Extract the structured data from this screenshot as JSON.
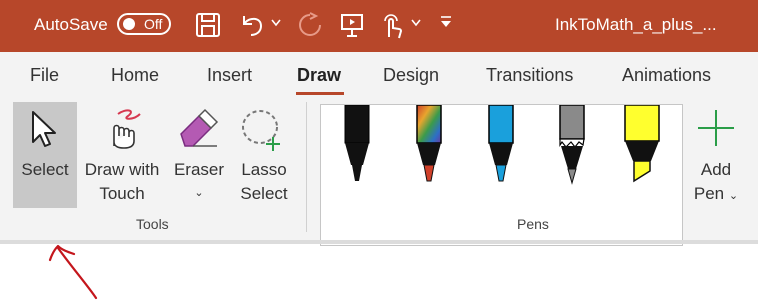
{
  "titlebar": {
    "autosave_label": "AutoSave",
    "autosave_state": "Off",
    "document_title": "InkToMath_a_plus_..."
  },
  "tabs": [
    {
      "label": "File"
    },
    {
      "label": "Home"
    },
    {
      "label": "Insert"
    },
    {
      "label": "Draw",
      "active": true
    },
    {
      "label": "Design"
    },
    {
      "label": "Transitions"
    },
    {
      "label": "Animations"
    }
  ],
  "tools_group": {
    "label": "Tools",
    "select": "Select",
    "draw_touch": [
      "Draw with",
      "Touch"
    ],
    "eraser": "Eraser",
    "lasso": [
      "Lasso",
      "Select"
    ]
  },
  "pens_group": {
    "label": "Pens",
    "add_pen": [
      "Add",
      "Pen"
    ],
    "pens": [
      {
        "name": "black-pen",
        "color": "#111111"
      },
      {
        "name": "galaxy-pen",
        "color": "#d0402a"
      },
      {
        "name": "blue-pen",
        "color": "#1aa0dc"
      },
      {
        "name": "gray-pencil",
        "color": "#8a8a8a"
      },
      {
        "name": "yellow-highlighter",
        "color": "#ffff2e"
      }
    ]
  },
  "colors": {
    "accent": "#B7472A",
    "ribbon_bg": "#f3f3f3",
    "selected_bg": "#c8c8c8",
    "add_pen_plus": "#2a9d48",
    "annotation_arrow": "#c4161c"
  }
}
